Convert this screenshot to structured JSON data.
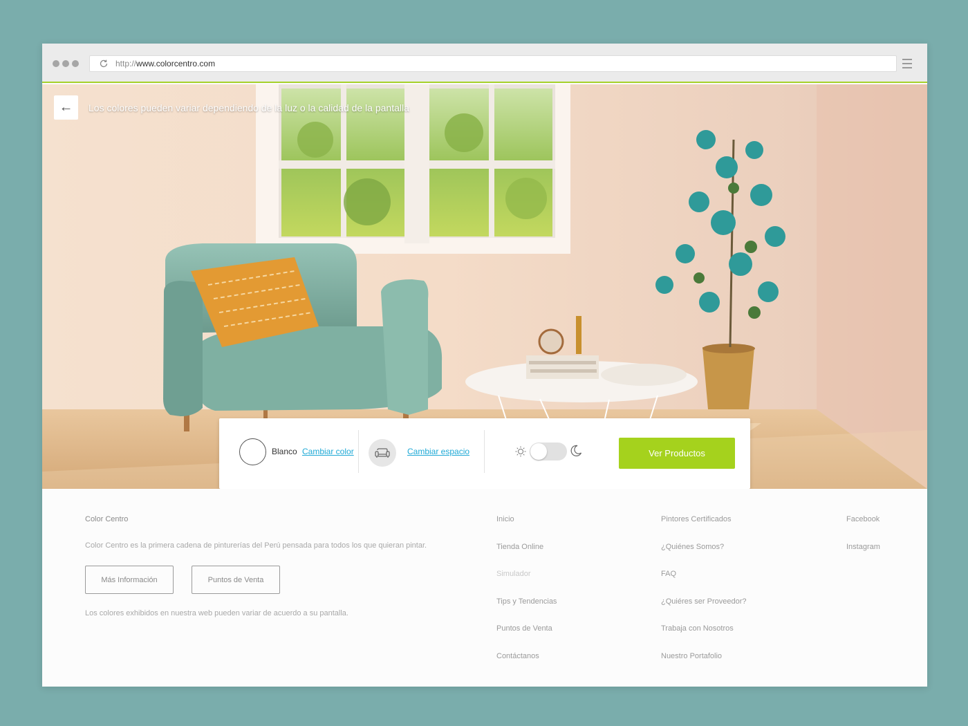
{
  "browser": {
    "url_protocol": "http://",
    "url_host": "www.colorcentro.com"
  },
  "hero": {
    "notice": "Los colores pueden variar dependiendo de la luz o la calidad de la pantalla"
  },
  "controls": {
    "color_name": "Blanco",
    "change_color_label": "Cambiar color",
    "change_space_label": "Cambiar espacio",
    "cta_label": "Ver Productos",
    "night_mode_on": false
  },
  "footer": {
    "brand": "Color Centro",
    "description": "Color Centro es la primera cadena de pinturerías del Perú pensada para todos los que quieran pintar.",
    "more_info_label": "Más Información",
    "points_of_sale_label": "Puntos de Venta",
    "disclaimer": "Los colores exhibidos en nuestra web pueden variar de acuerdo a su pantalla.",
    "nav_col1": [
      "Inicio",
      "Tienda Online",
      "Simulador",
      "Tips y Tendencias",
      "Puntos de Venta",
      "Contáctanos"
    ],
    "nav_col2": [
      "Pintores Certificados",
      "¿Quiénes Somos?",
      "FAQ",
      "¿Quiéres ser Proveedor?",
      "Trabaja con Nosotros",
      "Nuestro Portafolio"
    ],
    "social": [
      "Facebook",
      "Instagram"
    ]
  },
  "colors": {
    "accent": "#a5d21d",
    "link": "#1fa9d6",
    "background": "#7aadac"
  }
}
